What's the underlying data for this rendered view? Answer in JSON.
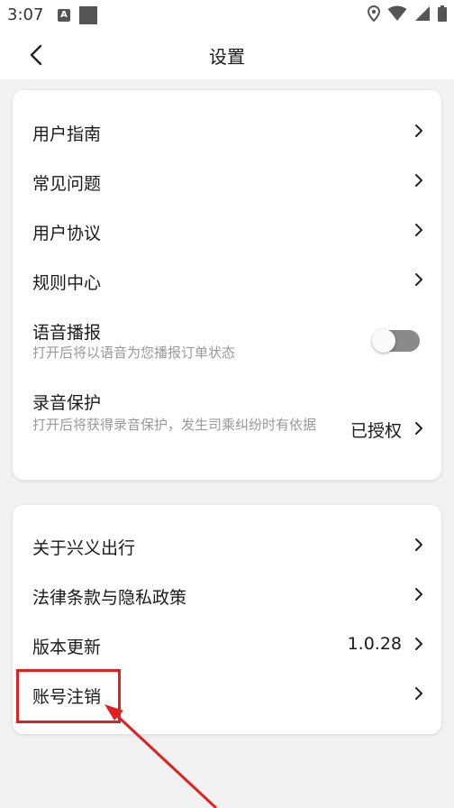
{
  "status_bar": {
    "time": "3:07",
    "a_icon_label": "A",
    "icons": [
      "a-icon",
      "square-icon",
      "location-icon",
      "wifi-icon",
      "signal-icon",
      "battery-icon"
    ]
  },
  "header": {
    "title": "设置",
    "back_icon": "chevron-left-icon"
  },
  "card1": {
    "user_guide": "用户指南",
    "faq": "常见问题",
    "user_agreement": "用户协议",
    "rules_center": "规则中心",
    "voice_broadcast": {
      "label": "语音播报",
      "desc": "打开后将以语音为您播报订单状态",
      "enabled": false
    },
    "recording_protection": {
      "label": "录音保护",
      "desc": "打开后将获得录音保护，发生司乘纠纷时有依据",
      "value": "已授权"
    }
  },
  "card2": {
    "about": "关于兴义出行",
    "legal": "法律条款与隐私政策",
    "version_update": {
      "label": "版本更新",
      "value": "1.0.28"
    },
    "account_cancel": "账号注销"
  },
  "colors": {
    "annotation": "#e02020",
    "background": "#f2f2f2",
    "card": "#ffffff",
    "toggle_off": "#8a8a8a",
    "secondary_text": "#999999"
  }
}
